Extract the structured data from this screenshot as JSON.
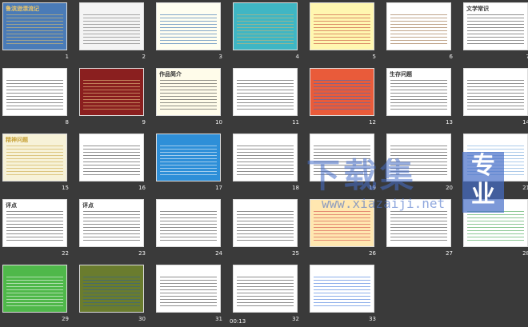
{
  "app": {
    "background": "#3a3a3a"
  },
  "slides": [
    {
      "n": "1",
      "title": "鲁滨逊漂流记",
      "bg": "#4a7bb7",
      "accent": "#e8c46a"
    },
    {
      "n": "2",
      "title": "",
      "bg": "#f4f4f4",
      "accent": "#666666"
    },
    {
      "n": "3",
      "title": "",
      "bg": "#fffef0",
      "accent": "#1c5ea8"
    },
    {
      "n": "4",
      "title": "",
      "bg": "#3fb6c4",
      "accent": "#d9b46c"
    },
    {
      "n": "5",
      "title": "",
      "bg": "#fff7b0",
      "accent": "#c0392b"
    },
    {
      "n": "6",
      "title": "",
      "bg": "#ffffff",
      "accent": "#8b5a2b"
    },
    {
      "n": "7",
      "title": "文学常识",
      "bg": "#ffffff",
      "accent": "#333333"
    },
    {
      "n": "8",
      "title": "",
      "bg": "#ffffff",
      "accent": "#333333"
    },
    {
      "n": "9",
      "title": "",
      "bg": "#8a1f1f",
      "accent": "#f2d28c"
    },
    {
      "n": "10",
      "title": "作品简介",
      "bg": "#fffcea",
      "accent": "#333333"
    },
    {
      "n": "11",
      "title": "",
      "bg": "#ffffff",
      "accent": "#333333"
    },
    {
      "n": "12",
      "title": "",
      "bg": "#e95b3a",
      "accent": "#2f70c8"
    },
    {
      "n": "13",
      "title": "生存问题",
      "bg": "#ffffff",
      "accent": "#333333"
    },
    {
      "n": "14",
      "title": "",
      "bg": "#ffffff",
      "accent": "#333333"
    },
    {
      "n": "15",
      "title": "精神问题",
      "bg": "#f7f2d8",
      "accent": "#c8a33a"
    },
    {
      "n": "16",
      "title": "",
      "bg": "#ffffff",
      "accent": "#333333"
    },
    {
      "n": "17",
      "title": "",
      "bg": "#2e8fd8",
      "accent": "#ffffff"
    },
    {
      "n": "18",
      "title": "",
      "bg": "#ffffff",
      "accent": "#333333"
    },
    {
      "n": "19",
      "title": "",
      "bg": "#ffffff",
      "accent": "#333333"
    },
    {
      "n": "20",
      "title": "",
      "bg": "#ffffff",
      "accent": "#333333"
    },
    {
      "n": "21",
      "title": "",
      "bg": "#ffffff",
      "accent": "#6aa0d8"
    },
    {
      "n": "22",
      "title": "评点",
      "bg": "#ffffff",
      "accent": "#333333"
    },
    {
      "n": "23",
      "title": "评点",
      "bg": "#ffffff",
      "accent": "#333333"
    },
    {
      "n": "24",
      "title": "",
      "bg": "#ffffff",
      "accent": "#333333"
    },
    {
      "n": "25",
      "title": "",
      "bg": "#ffffff",
      "accent": "#333333"
    },
    {
      "n": "26",
      "title": "",
      "bg": "#ffe7b0",
      "accent": "#d04040"
    },
    {
      "n": "27",
      "title": "",
      "bg": "#ffffff",
      "accent": "#333333"
    },
    {
      "n": "28",
      "title": "",
      "bg": "#ffffff",
      "accent": "#2f9b3e"
    },
    {
      "n": "29",
      "title": "",
      "bg": "#4fb84a",
      "accent": "#ffffff"
    },
    {
      "n": "30",
      "title": "",
      "bg": "#6a7c2e",
      "accent": "#2a5ea0"
    },
    {
      "n": "31",
      "title": "",
      "bg": "#ffffff",
      "accent": "#333333"
    },
    {
      "n": "32",
      "title": "",
      "bg": "#ffffff",
      "accent": "#333333"
    },
    {
      "n": "33",
      "title": "",
      "bg": "#ffffff",
      "accent": "#2f6bd8"
    }
  ],
  "status": {
    "time": "00:13"
  },
  "watermark": {
    "main": "下载集",
    "side": "专业",
    "url": "www.xiazaiji.net"
  }
}
